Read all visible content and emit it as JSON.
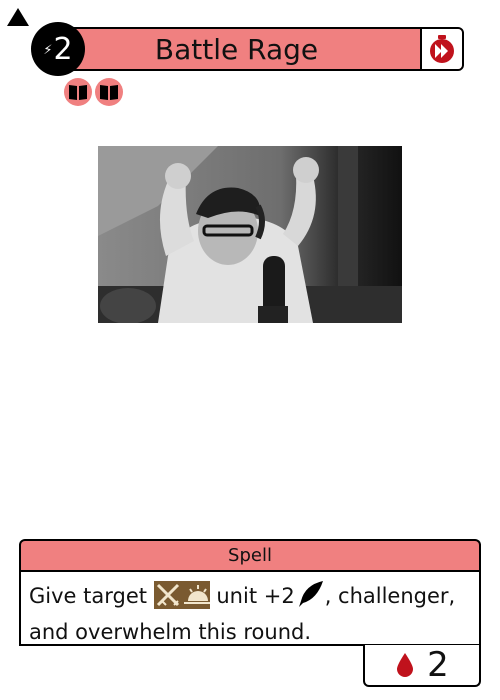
{
  "card": {
    "title": "Battle Rage",
    "energy": "2",
    "speed_icon": "burst-speed-icon",
    "keyword_icons": [
      "book-icon",
      "book-icon"
    ],
    "type_label": "Spell",
    "description": {
      "part1": "Give target",
      "part2": "unit +2",
      "part3": ", challenger,",
      "line2": "and overwhelm this round."
    },
    "cost": "2",
    "cost_icon": "blood-drop-icon"
  },
  "colors": {
    "accent": "#f08080",
    "border": "#000000",
    "cost_drop": "#c0121c",
    "tag_brown": "#7a5a30"
  }
}
